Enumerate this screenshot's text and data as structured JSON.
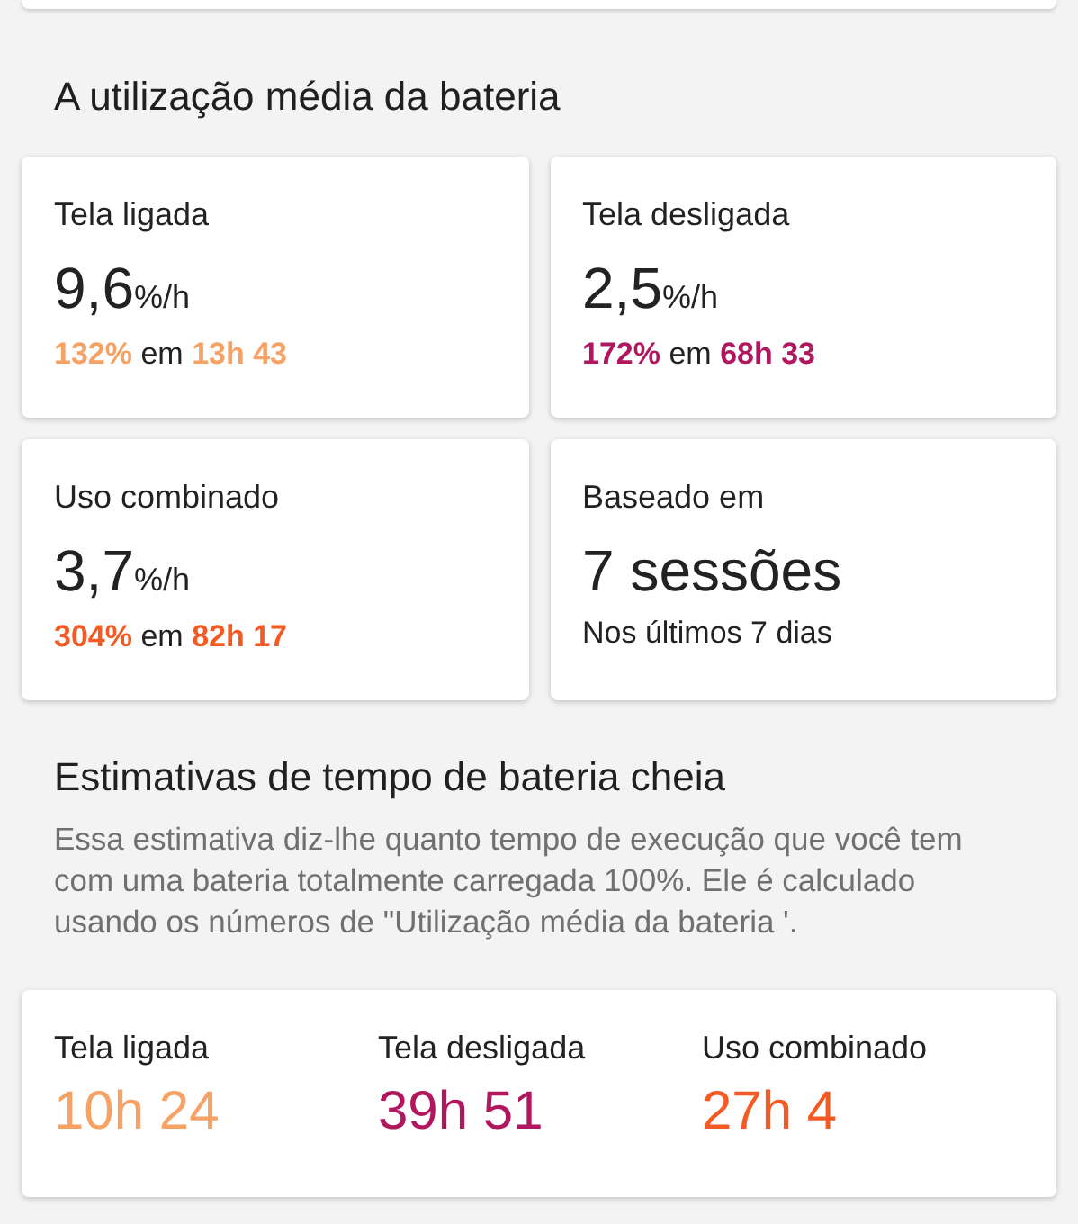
{
  "average_usage": {
    "title": "A utilização média da bateria",
    "cards": [
      {
        "kind": "rate",
        "label": "Tela ligada",
        "value": "9,6",
        "unit": "%/h",
        "percent": "132%",
        "connector": "em",
        "duration": "13h 43",
        "color": "#f6a265"
      },
      {
        "kind": "rate",
        "label": "Tela desligada",
        "value": "2,5",
        "unit": "%/h",
        "percent": "172%",
        "connector": "em",
        "duration": "68h 33",
        "color": "#b0175e"
      },
      {
        "kind": "rate",
        "label": "Uso combinado",
        "value": "3,7",
        "unit": "%/h",
        "percent": "304%",
        "connector": "em",
        "duration": "82h 17",
        "color": "#f45a24"
      },
      {
        "kind": "sessions",
        "label": "Baseado em",
        "value": "7 sessões",
        "note": "Nos últimos 7 dias"
      }
    ]
  },
  "full_charge_estimates": {
    "title": "Estimativas de tempo de bateria cheia",
    "description": "Essa estimativa diz-lhe quanto tempo de execução que você tem com uma bateria totalmente carregada 100%. Ele é calculado usando os números de \"Utilização média da bateria '.",
    "items": [
      {
        "label": "Tela ligada",
        "value": "10h 24",
        "color": "#f6a265"
      },
      {
        "label": "Tela desligada",
        "value": "39h 51",
        "color": "#b0175e"
      },
      {
        "label": "Uso combinado",
        "value": "27h 4",
        "color": "#f45a24"
      }
    ]
  }
}
